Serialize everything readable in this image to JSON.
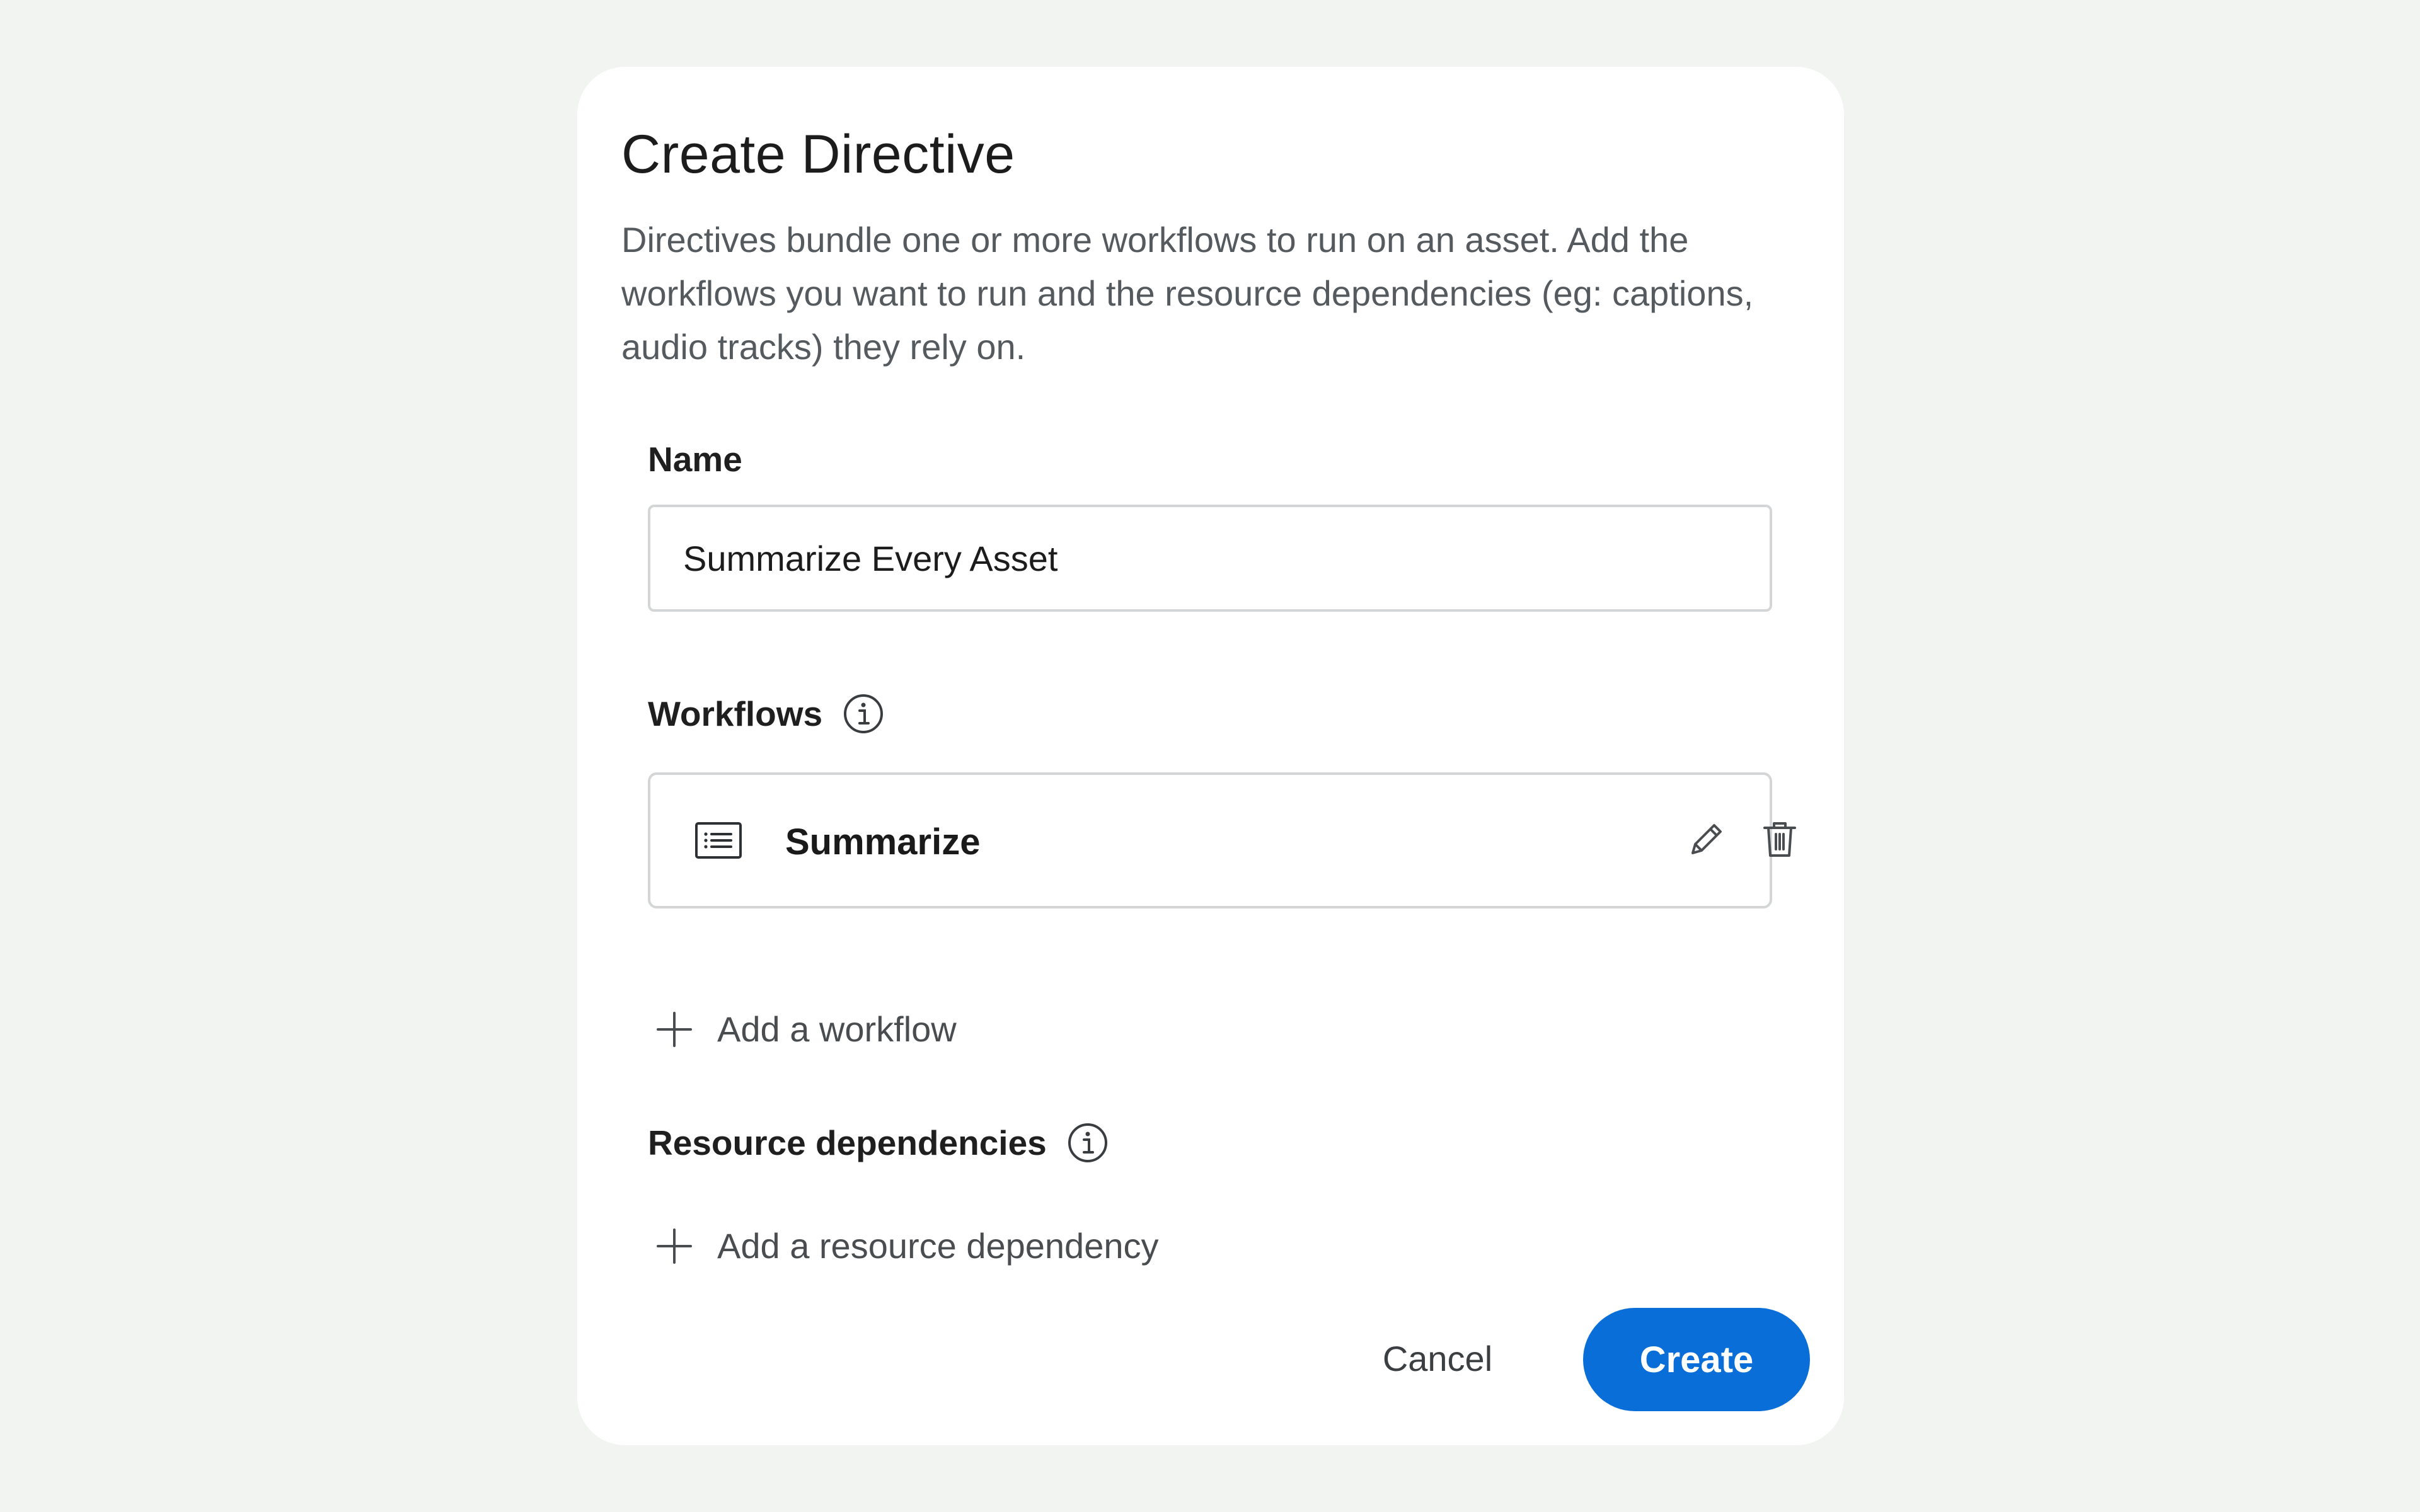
{
  "dialog": {
    "title": "Create Directive",
    "description": "Directives bundle one or more workflows to run on an asset. Add the workflows you want to run and the resource dependencies (eg: captions, audio tracks) they rely on."
  },
  "name_field": {
    "label": "Name",
    "value": "Summarize Every Asset"
  },
  "workflows": {
    "label": "Workflows",
    "items": [
      {
        "name": "Summarize",
        "icon": "list-icon"
      }
    ],
    "add_label": "Add a workflow"
  },
  "resource_dependencies": {
    "label": "Resource dependencies",
    "add_label": "Add a resource dependency"
  },
  "actions": {
    "cancel_label": "Cancel",
    "create_label": "Create"
  },
  "colors": {
    "primary": "#0a6ed9",
    "background": "#f2f4f2",
    "surface": "#ffffff",
    "border": "#d3d5d6"
  }
}
